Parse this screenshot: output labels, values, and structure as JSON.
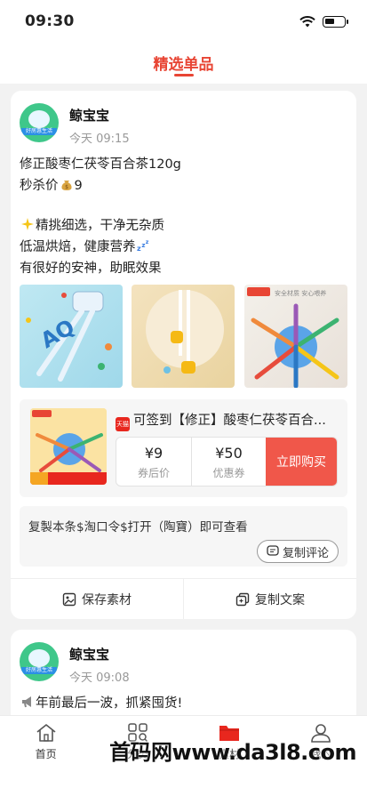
{
  "status": {
    "time": "09:30"
  },
  "header": {
    "title": "精选单品"
  },
  "post1": {
    "author": "鲸宝宝",
    "timestamp": "今天 09:15",
    "avatar_tag": "好房惠生活",
    "lines": [
      "修正酸枣仁茯苓百合茶120g",
      "秒杀价",
      "9",
      "精挑细选，干净无杂质",
      "低温烘焙，健康营养",
      "有很好的安神，助眠效果"
    ],
    "product": {
      "title": "可签到【修正】酸枣仁茯苓百合...",
      "coupon_price": "¥9",
      "coupon_price_label": "券后价",
      "discount": "¥50",
      "discount_label": "优惠券",
      "buy_label": "立即购买"
    },
    "comment": "复製本条$淘口令$打开（陶寶）即可查看",
    "copy_comment_label": "复制评论",
    "save_material_label": "保存素材",
    "copy_text_label": "复制文案"
  },
  "post2": {
    "author": "鲸宝宝",
    "timestamp": "今天 09:08",
    "avatar_tag": "好房惠生活",
    "line1": "年前最后一波，抓紧囤货!"
  },
  "nav": {
    "items": [
      {
        "label": "首页",
        "icon": "home-icon"
      },
      {
        "label": "分类",
        "icon": "category-icon"
      },
      {
        "label": "素材",
        "icon": "folder-icon"
      },
      {
        "label": "我的",
        "icon": "user-icon"
      }
    ]
  },
  "watermark": "首码网www.da3l8.com",
  "colors": {
    "accent": "#e84534",
    "buy": "#f0574a"
  }
}
